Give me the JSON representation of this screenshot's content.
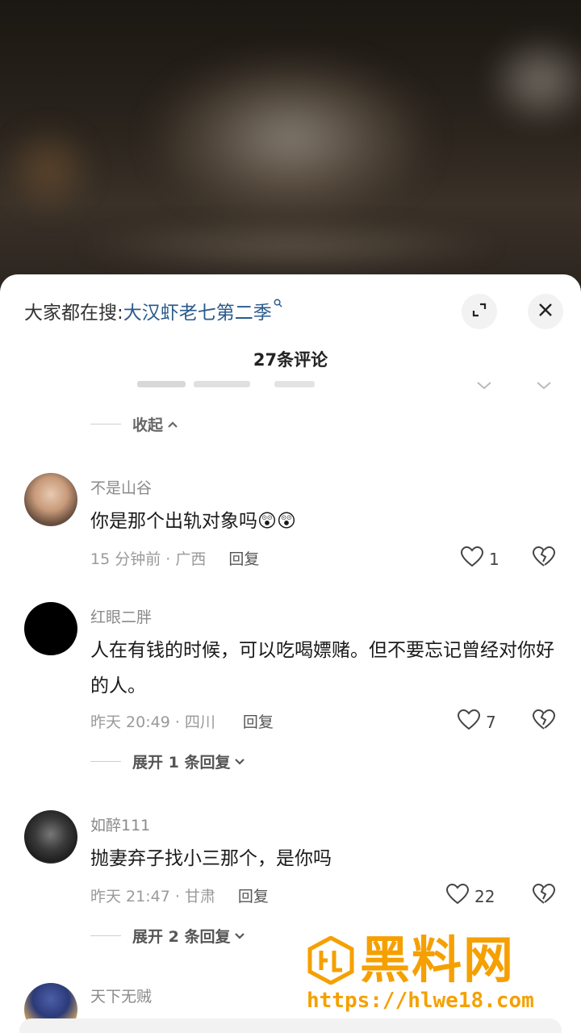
{
  "search": {
    "prefix": "大家都在搜:",
    "query": "大汉虾老七第二季",
    "search_icon": "search-icon"
  },
  "header": {
    "count_title": "27条评论",
    "expand_icon": "expand-icon",
    "close_icon": "close-icon"
  },
  "collapse": {
    "label": "收起"
  },
  "comments": [
    {
      "username": "不是山谷",
      "text": "你是那个出轨对象吗😲😲",
      "time_location": "15 分钟前 · 广西",
      "reply_label": "回复",
      "likes": "1"
    },
    {
      "username": "红眼二胖",
      "text": "人在有钱的时候，可以吃喝嫖赌。但不要忘记曾经对你好的人。",
      "time_location": "昨天 20:49 · 四川",
      "reply_label": "回复",
      "likes": "7",
      "expand_label": "展开 1 条回复"
    },
    {
      "username": "如醉111",
      "text": "抛妻弃子找小三那个，是你吗",
      "time_location": "昨天 21:47 · 甘肃",
      "reply_label": "回复",
      "likes": "22",
      "expand_label": "展开 2 条回复"
    },
    {
      "username": "天下无贼"
    }
  ],
  "watermark": {
    "text": "黑料网",
    "url": "https://hlwe18.com",
    "color": "#f5a000"
  }
}
